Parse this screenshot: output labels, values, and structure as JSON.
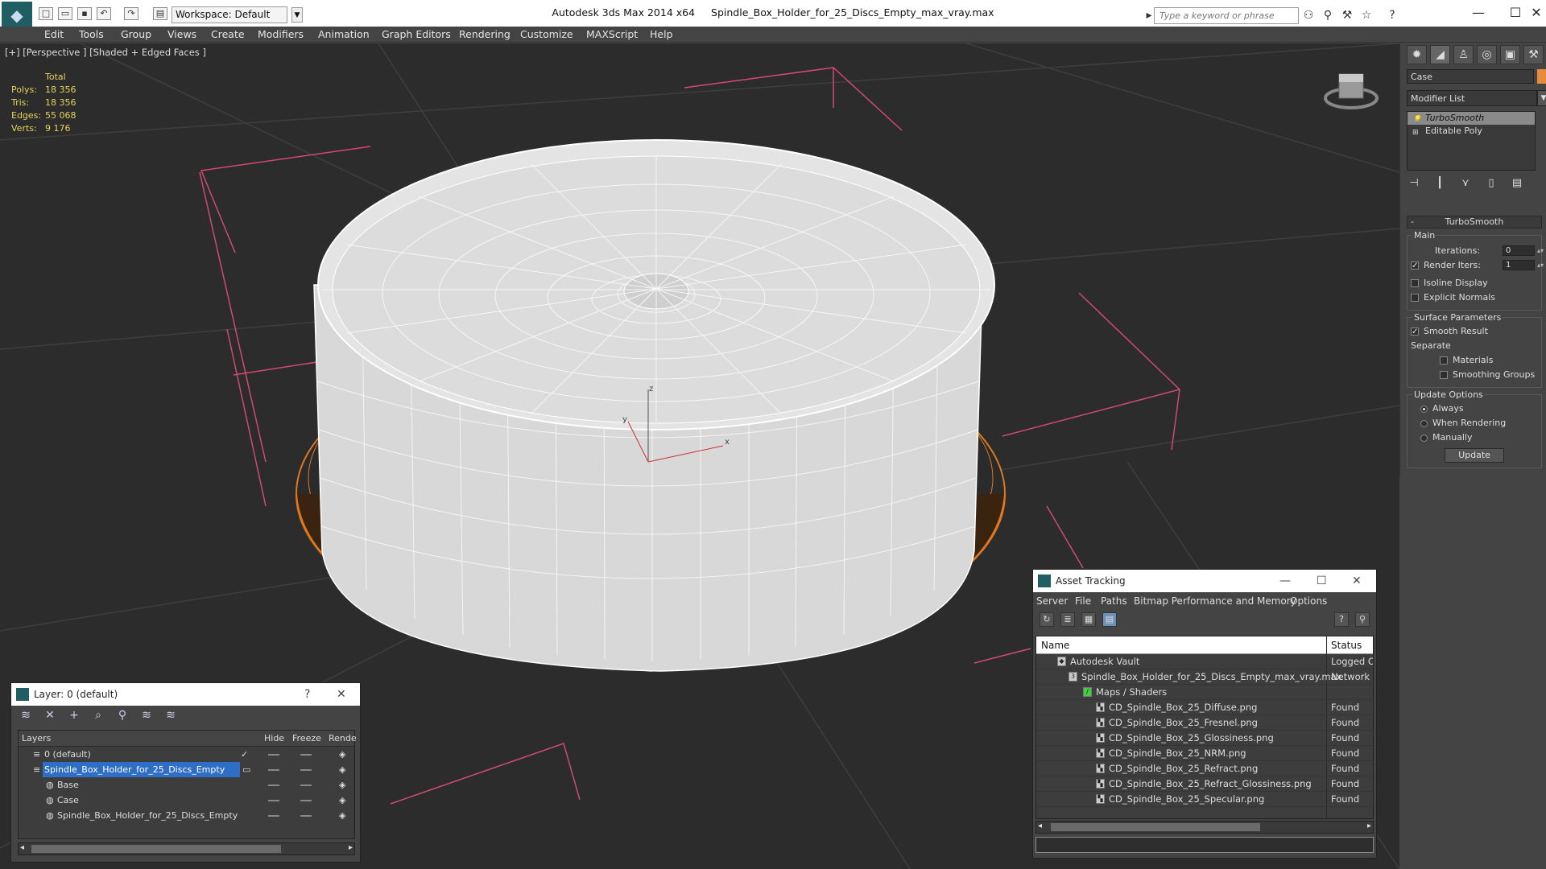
{
  "titlebar": {
    "workspace": "Workspace: Default",
    "app": "Autodesk 3ds Max  2014 x64",
    "file": "Spindle_Box_Holder_for_25_Discs_Empty_max_vray.max",
    "search_placeholder": "Type a keyword or phrase",
    "minimize": "—",
    "maximize": "☐",
    "close": "✕"
  },
  "menu": [
    "Edit",
    "Tools",
    "Group",
    "Views",
    "Create",
    "Modifiers",
    "Animation",
    "Graph Editors",
    "Rendering",
    "Customize",
    "MAXScript",
    "Help"
  ],
  "viewport": {
    "label": "[+] [Perspective ] [Shaded + Edged Faces ]",
    "stats": {
      "header": "Total",
      "rows": [
        {
          "k": "Polys:",
          "v": "18 356"
        },
        {
          "k": "Tris:",
          "v": "18 356"
        },
        {
          "k": "Edges:",
          "v": "55 068"
        },
        {
          "k": "Verts:",
          "v": "9 176"
        }
      ]
    },
    "axes": {
      "x": "x",
      "y": "y",
      "z": "z"
    }
  },
  "command_panel": {
    "object_name": "Case",
    "object_color": "#e68b3a",
    "modifier_list": "Modifier List",
    "stack": [
      "TurboSmooth",
      "Editable Poly"
    ],
    "rollout": "TurboSmooth",
    "main_group": "Main",
    "iterations_label": "Iterations:",
    "iterations_value": "0",
    "render_iters_label": "Render Iters:",
    "render_iters_value": "1",
    "isoline": "Isoline Display",
    "explicit_normals": "Explicit Normals",
    "surface_group": "Surface Parameters",
    "smooth_result": "Smooth Result",
    "separate": "Separate",
    "materials": "Materials",
    "smoothing_groups": "Smoothing Groups",
    "update_group": "Update Options",
    "always": "Always",
    "when_rendering": "When Rendering",
    "manually": "Manually",
    "update_btn": "Update"
  },
  "layer_panel": {
    "title": "Layer: 0 (default)",
    "help": "?",
    "close": "✕",
    "columns": {
      "layers": "Layers",
      "hide": "Hide",
      "freeze": "Freeze",
      "render": "Rende"
    },
    "rows": [
      {
        "name": "0 (default)",
        "indent": 0
      },
      {
        "name": "Spindle_Box_Holder_for_25_Discs_Empty",
        "indent": 0
      },
      {
        "name": "Base",
        "indent": 1
      },
      {
        "name": "Case",
        "indent": 1
      },
      {
        "name": "Spindle_Box_Holder_for_25_Discs_Empty",
        "indent": 1
      }
    ]
  },
  "asset_panel": {
    "title": "Asset Tracking",
    "menu": [
      "Server",
      "File",
      "Paths",
      "Bitmap Performance and Memory",
      "Options"
    ],
    "columns": {
      "name": "Name",
      "status": "Status"
    },
    "rows": [
      {
        "name": "Autodesk Vault",
        "status": "Logged Ou"
      },
      {
        "name": "Spindle_Box_Holder_for_25_Discs_Empty_max_vray.max",
        "status": "Network P"
      },
      {
        "name": "Maps / Shaders",
        "status": ""
      },
      {
        "name": "CD_Spindle_Box_25_Diffuse.png",
        "status": "Found"
      },
      {
        "name": "CD_Spindle_Box_25_Fresnel.png",
        "status": "Found"
      },
      {
        "name": "CD_Spindle_Box_25_Glossiness.png",
        "status": "Found"
      },
      {
        "name": "CD_Spindle_Box_25_NRM.png",
        "status": "Found"
      },
      {
        "name": "CD_Spindle_Box_25_Refract.png",
        "status": "Found"
      },
      {
        "name": "CD_Spindle_Box_25_Refract_Glossiness.png",
        "status": "Found"
      },
      {
        "name": "CD_Spindle_Box_25_Specular.png",
        "status": "Found"
      }
    ]
  }
}
